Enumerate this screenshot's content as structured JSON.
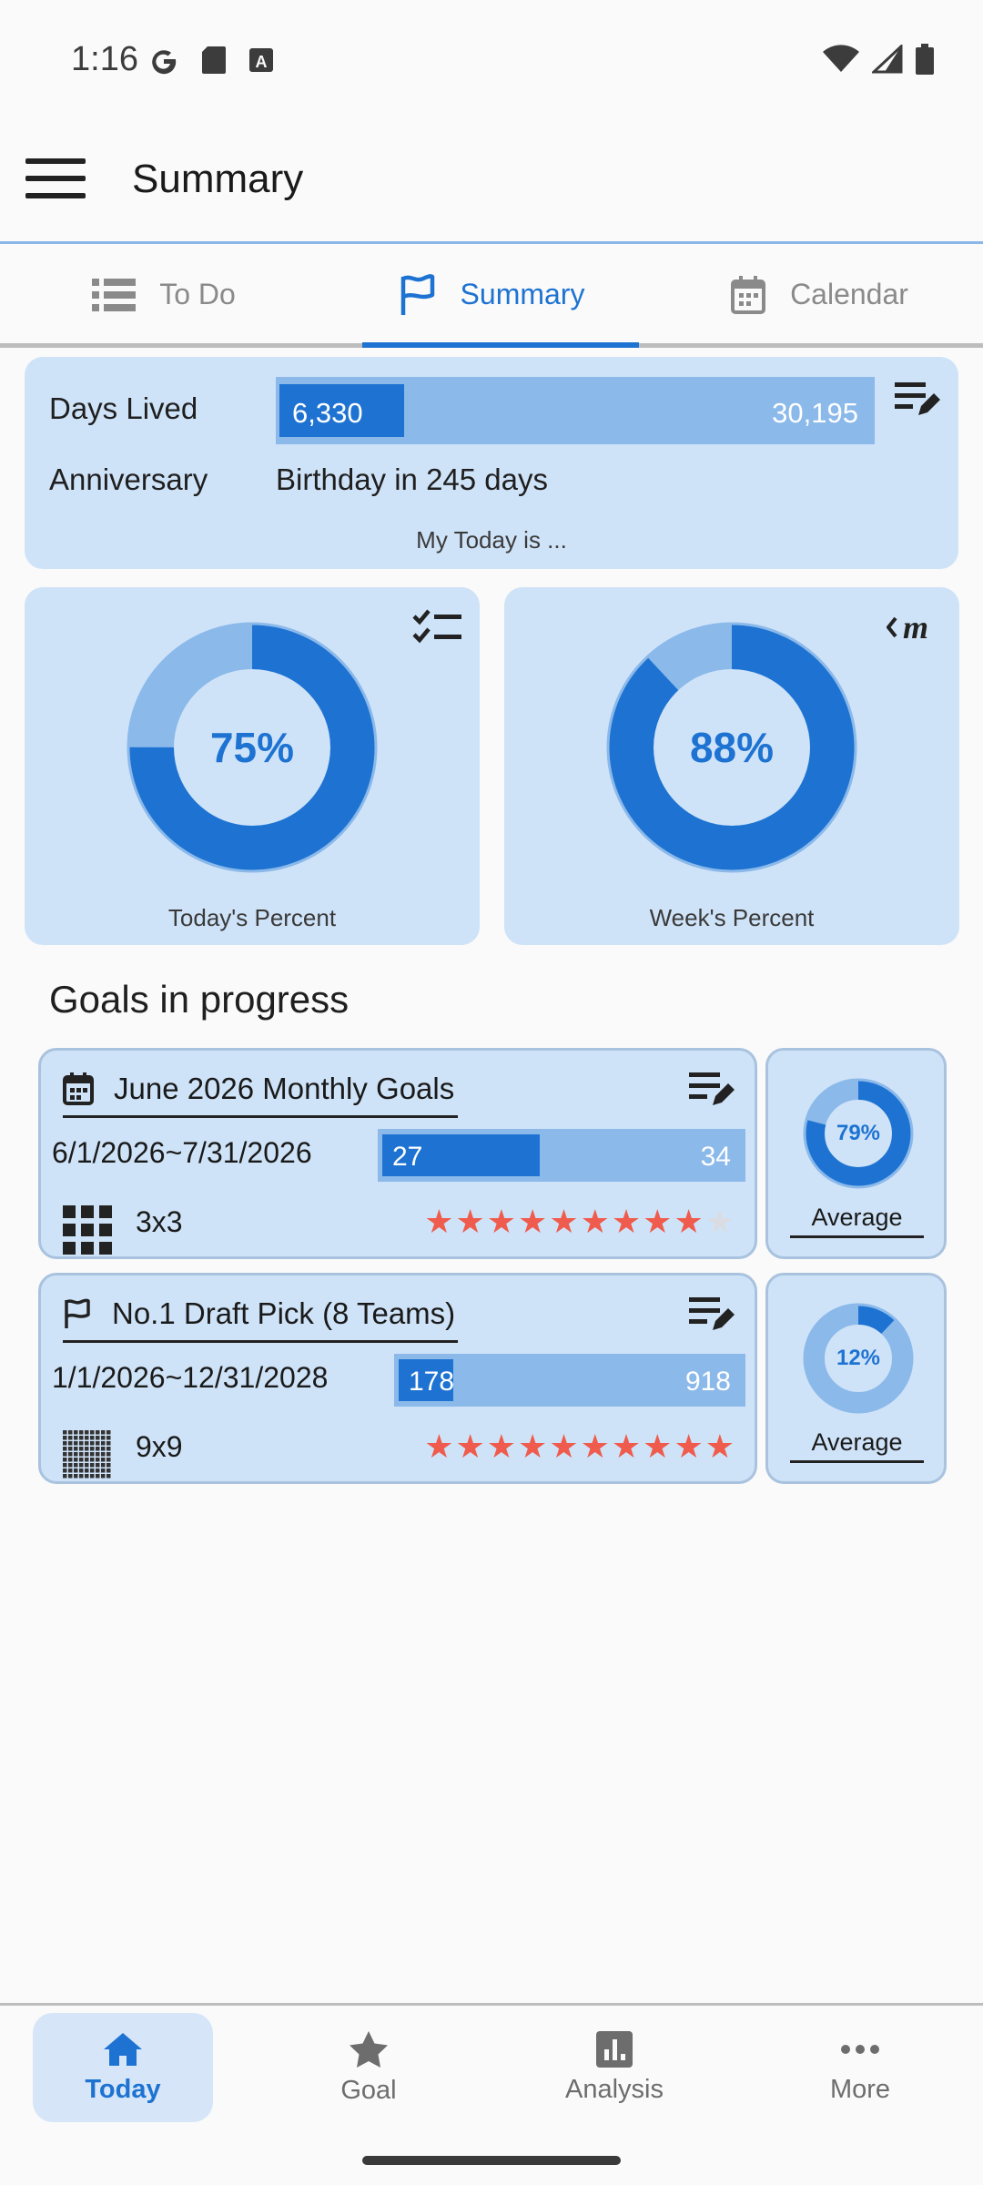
{
  "status_bar": {
    "time": "1:16",
    "left_icons": [
      "google-icon",
      "sd-card-icon",
      "text-icon"
    ],
    "right_icons": [
      "wifi-icon",
      "signal-icon",
      "battery-icon"
    ]
  },
  "app_bar": {
    "title": "Summary",
    "menu_icon": "menu-icon"
  },
  "tabs": [
    {
      "label": "To Do",
      "icon": "list-icon",
      "active": false
    },
    {
      "label": "Summary",
      "icon": "flag-icon",
      "active": true
    },
    {
      "label": "Calendar",
      "icon": "calendar-icon",
      "active": false
    }
  ],
  "days_card": {
    "days_lived_label": "Days Lived",
    "days_lived_value": "6,330",
    "days_total_value": "30,195",
    "days_fraction": 0.21,
    "anniversary_label": "Anniversary",
    "anniversary_value": "Birthday in 245 days",
    "footer": "My Today is ..."
  },
  "percent_cards": [
    {
      "label": "Today's Percent",
      "percent_text": "75%",
      "fraction": 0.75,
      "icon": "checklist-icon"
    },
    {
      "label": "Week's Percent",
      "percent_text": "88%",
      "fraction": 0.88,
      "icon": "m-icon"
    }
  ],
  "goals_section": {
    "title": "Goals in progress",
    "goals": [
      {
        "title": "June 2026 Monthly Goals",
        "icon": "calendar-icon",
        "range": "6/1/2026~7/31/2026",
        "progress_value": "27",
        "progress_total": "34",
        "progress_fraction": 0.44,
        "grid_label": "3x3",
        "grid_icon": "grid-3x3-icon",
        "stars_filled": 9,
        "stars_total": 10,
        "average_text": "79%",
        "average_fraction": 0.79,
        "average_label": "Average"
      },
      {
        "title": "No.1 Draft Pick (8 Teams)",
        "icon": "flag-icon",
        "range": "1/1/2026~12/31/2028",
        "progress_value": "178",
        "progress_total": "918",
        "progress_fraction": 0.16,
        "grid_label": "9x9",
        "grid_icon": "grid-9x9-icon",
        "stars_filled": 10,
        "stars_total": 10,
        "average_text": "12%",
        "average_fraction": 0.12,
        "average_label": "Average"
      }
    ]
  },
  "bottom_nav": [
    {
      "label": "Today",
      "icon": "home-icon",
      "active": true
    },
    {
      "label": "Goal",
      "icon": "star-icon",
      "active": false
    },
    {
      "label": "Analysis",
      "icon": "chart-icon",
      "active": false
    },
    {
      "label": "More",
      "icon": "more-icon",
      "active": false
    }
  ],
  "colors": {
    "accent": "#1e73d2",
    "card_bg": "#cfe3f8",
    "bar_bg": "#8bb9ea",
    "star_on": "#ef5b4c",
    "star_off": "#d9dde3"
  }
}
